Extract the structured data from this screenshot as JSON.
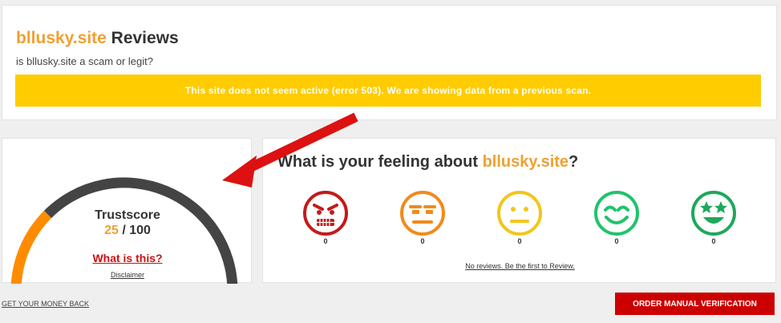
{
  "header": {
    "site": "bllusky.site",
    "title_suffix": " Reviews",
    "subtitle": "is bllusky.site a scam or legit?",
    "banner_text": "This site does not seem active (error 503). We are showing data from a previous scan."
  },
  "score": {
    "label": "Trustscore",
    "value": "25",
    "separator": " / ",
    "max": "100",
    "gauge_fraction": 0.25,
    "what_link": "What is this?",
    "disclaimer": "Disclaimer"
  },
  "feeling": {
    "prefix": "What is your feeling about ",
    "site": "bllusky.site",
    "suffix": "?",
    "faces": [
      {
        "icon": "angry-face-icon",
        "color": "#c41a1a",
        "count": "0"
      },
      {
        "icon": "unamused-face-icon",
        "color": "#f28a1a",
        "count": "0"
      },
      {
        "icon": "neutral-face-icon",
        "color": "#f2c61a",
        "count": "0"
      },
      {
        "icon": "smiling-face-icon",
        "color": "#1fc46a",
        "count": "0"
      },
      {
        "icon": "star-struck-face-icon",
        "color": "#1fa85a",
        "count": "0"
      }
    ],
    "no_reviews": "No reviews. Be the first to Review."
  },
  "footer": {
    "money_back": "GET YOUR MONEY BACK",
    "order_button": "ORDER MANUAL VERIFICATION"
  },
  "colors": {
    "accent": "#f0a030",
    "banner": "#ffcc00",
    "gauge_fill": "#ff8c00",
    "gauge_track": "#444444",
    "cta": "#cc0000",
    "arrow": "#dd1111"
  }
}
